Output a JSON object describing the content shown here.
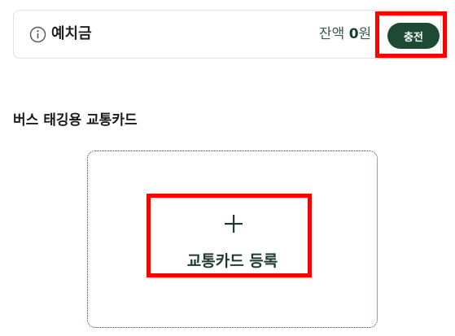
{
  "deposit": {
    "label": "예치금",
    "balance_prefix": "잔액",
    "balance_amount": "0",
    "balance_unit": "원",
    "charge_label": "충전"
  },
  "section": {
    "title": "버스 태깅용 교통카드"
  },
  "add_card": {
    "label": "교통카드 등록"
  },
  "colors": {
    "accent": "#1c4a33",
    "highlight": "#ff0000"
  },
  "icons": {
    "info": "info-circle-icon",
    "add": "plus-icon"
  }
}
